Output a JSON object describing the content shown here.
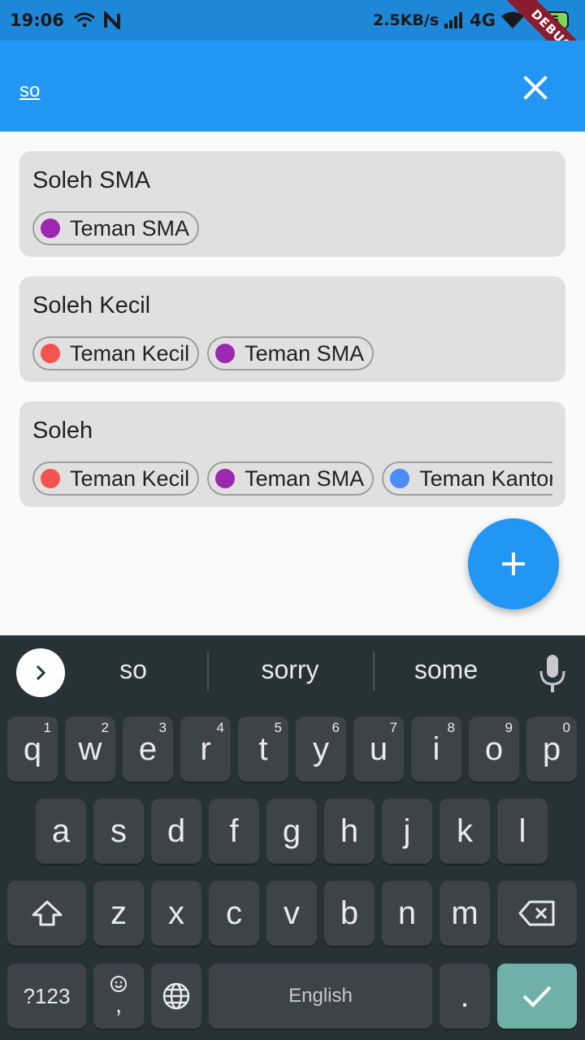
{
  "status_bar": {
    "time": "19:06",
    "net_speed": "2.5KB/s",
    "network": "4G",
    "battery": "55",
    "debug_label": "DEBUG"
  },
  "app_bar": {
    "search_value": "so"
  },
  "contacts": [
    {
      "name": "Soleh SMA",
      "groups": [
        {
          "label": "Teman SMA",
          "color": "#9c27b0"
        }
      ]
    },
    {
      "name": "Soleh Kecil",
      "groups": [
        {
          "label": "Teman Kecil",
          "color": "#f4544f"
        },
        {
          "label": "Teman SMA",
          "color": "#9c27b0"
        }
      ]
    },
    {
      "name": "Soleh",
      "groups": [
        {
          "label": "Teman Kecil",
          "color": "#f4544f"
        },
        {
          "label": "Teman SMA",
          "color": "#9c27b0"
        },
        {
          "label": "Teman Kantor",
          "color": "#4b8df8"
        }
      ]
    }
  ],
  "keyboard": {
    "suggestions": [
      "so",
      "sorry",
      "some"
    ],
    "row1": [
      {
        "k": "q",
        "h": "1"
      },
      {
        "k": "w",
        "h": "2"
      },
      {
        "k": "e",
        "h": "3"
      },
      {
        "k": "r",
        "h": "4"
      },
      {
        "k": "t",
        "h": "5"
      },
      {
        "k": "y",
        "h": "6"
      },
      {
        "k": "u",
        "h": "7"
      },
      {
        "k": "i",
        "h": "8"
      },
      {
        "k": "o",
        "h": "9"
      },
      {
        "k": "p",
        "h": "0"
      }
    ],
    "row2": [
      "a",
      "s",
      "d",
      "f",
      "g",
      "h",
      "j",
      "k",
      "l"
    ],
    "row3": [
      "z",
      "x",
      "c",
      "v",
      "b",
      "n",
      "m"
    ],
    "symbols_label": "?123",
    "comma_label": ",",
    "space_label": "English",
    "period_label": "."
  }
}
